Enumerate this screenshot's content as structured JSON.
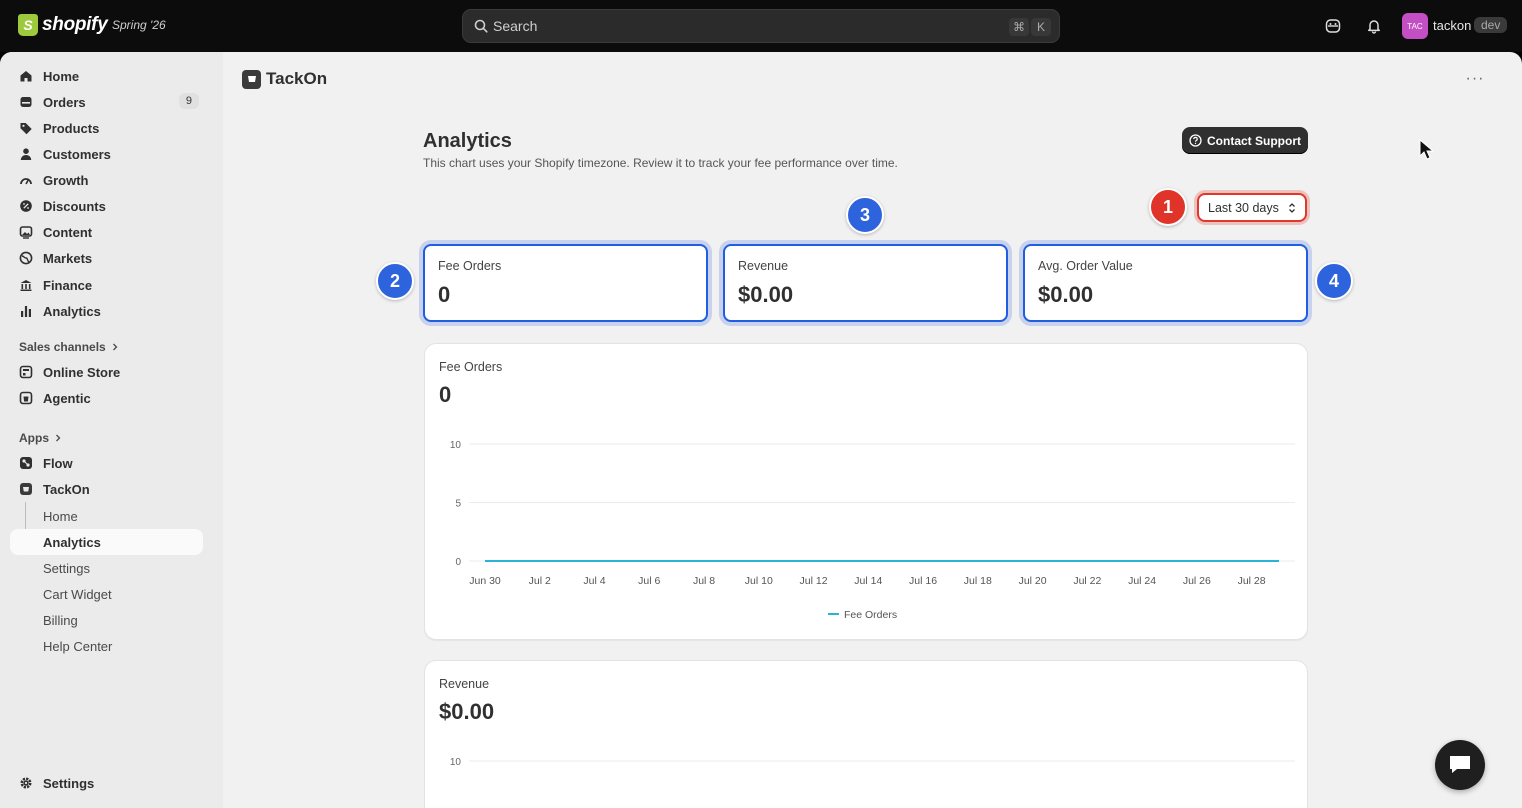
{
  "topbar": {
    "brand": "shopify",
    "edition": "Spring '26",
    "search_placeholder": "Search",
    "shortcut_mod": "⌘",
    "shortcut_key": "K",
    "avatar_initials": "TAC",
    "store_name": "tackon",
    "store_badge": "dev"
  },
  "sidebar": {
    "main_items": [
      {
        "label": "Home",
        "icon": "home-icon"
      },
      {
        "label": "Orders",
        "icon": "orders-icon",
        "count": "9"
      },
      {
        "label": "Products",
        "icon": "tag-icon"
      },
      {
        "label": "Customers",
        "icon": "person-icon"
      },
      {
        "label": "Growth",
        "icon": "gauge-icon"
      },
      {
        "label": "Discounts",
        "icon": "discount-icon"
      },
      {
        "label": "Content",
        "icon": "image-icon"
      },
      {
        "label": "Markets",
        "icon": "globe-icon"
      },
      {
        "label": "Finance",
        "icon": "bank-icon"
      },
      {
        "label": "Analytics",
        "icon": "bar-chart-icon"
      }
    ],
    "sales_channels_label": "Sales channels",
    "sales_channels": [
      {
        "label": "Online Store",
        "icon": "store-icon"
      },
      {
        "label": "Agentic",
        "icon": "agentic-icon"
      }
    ],
    "apps_label": "Apps",
    "apps": [
      {
        "label": "Flow",
        "icon": "flow-icon"
      },
      {
        "label": "TackOn",
        "icon": "tackon-app-icon"
      }
    ],
    "tackon_subitems": [
      {
        "label": "Home"
      },
      {
        "label": "Analytics",
        "active": true
      },
      {
        "label": "Settings"
      },
      {
        "label": "Cart Widget"
      },
      {
        "label": "Billing"
      },
      {
        "label": "Help Center"
      }
    ],
    "settings_label": "Settings"
  },
  "app_header": {
    "title": "TackOn"
  },
  "page": {
    "title": "Analytics",
    "subtitle": "This chart uses your Shopify timezone. Review it to track your fee performance over time.",
    "contact_support": "Contact Support",
    "date_range": "Last 30 days"
  },
  "markers": [
    "1",
    "2",
    "3",
    "4"
  ],
  "stats": [
    {
      "label": "Fee Orders",
      "value": "0"
    },
    {
      "label": "Revenue",
      "value": "$0.00"
    },
    {
      "label": "Avg. Order Value",
      "value": "$0.00"
    }
  ],
  "chart_cards": [
    {
      "label": "Fee Orders",
      "value": "0"
    },
    {
      "label": "Revenue",
      "value": "$0.00"
    }
  ],
  "colors": {
    "accent_blue": "#2d63dc",
    "marker_red": "#e0332a",
    "series_line": "#29b3d6"
  },
  "chart_data": [
    {
      "type": "line",
      "title": "Fee Orders",
      "x": [
        "Jun 30",
        "Jul 1",
        "Jul 2",
        "Jul 3",
        "Jul 4",
        "Jul 5",
        "Jul 6",
        "Jul 7",
        "Jul 8",
        "Jul 9",
        "Jul 10",
        "Jul 11",
        "Jul 12",
        "Jul 13",
        "Jul 14",
        "Jul 15",
        "Jul 16",
        "Jul 17",
        "Jul 18",
        "Jul 19",
        "Jul 20",
        "Jul 21",
        "Jul 22",
        "Jul 23",
        "Jul 24",
        "Jul 25",
        "Jul 26",
        "Jul 27",
        "Jul 28",
        "Jul 29"
      ],
      "x_tick_labels": [
        "Jun 30",
        "Jul 2",
        "Jul 4",
        "Jul 6",
        "Jul 8",
        "Jul 10",
        "Jul 12",
        "Jul 14",
        "Jul 16",
        "Jul 18",
        "Jul 20",
        "Jul 22",
        "Jul 24",
        "Jul 26",
        "Jul 28"
      ],
      "series": [
        {
          "name": "Fee Orders",
          "values": [
            0,
            0,
            0,
            0,
            0,
            0,
            0,
            0,
            0,
            0,
            0,
            0,
            0,
            0,
            0,
            0,
            0,
            0,
            0,
            0,
            0,
            0,
            0,
            0,
            0,
            0,
            0,
            0,
            0,
            0
          ]
        }
      ],
      "y_ticks": [
        "0",
        "5",
        "10"
      ],
      "ylim": [
        0,
        10
      ],
      "grid": true,
      "legend": "bottom-center"
    },
    {
      "type": "line",
      "title": "Revenue",
      "y_ticks": [
        "10"
      ],
      "ylim": [
        0,
        10
      ],
      "grid": true
    }
  ]
}
